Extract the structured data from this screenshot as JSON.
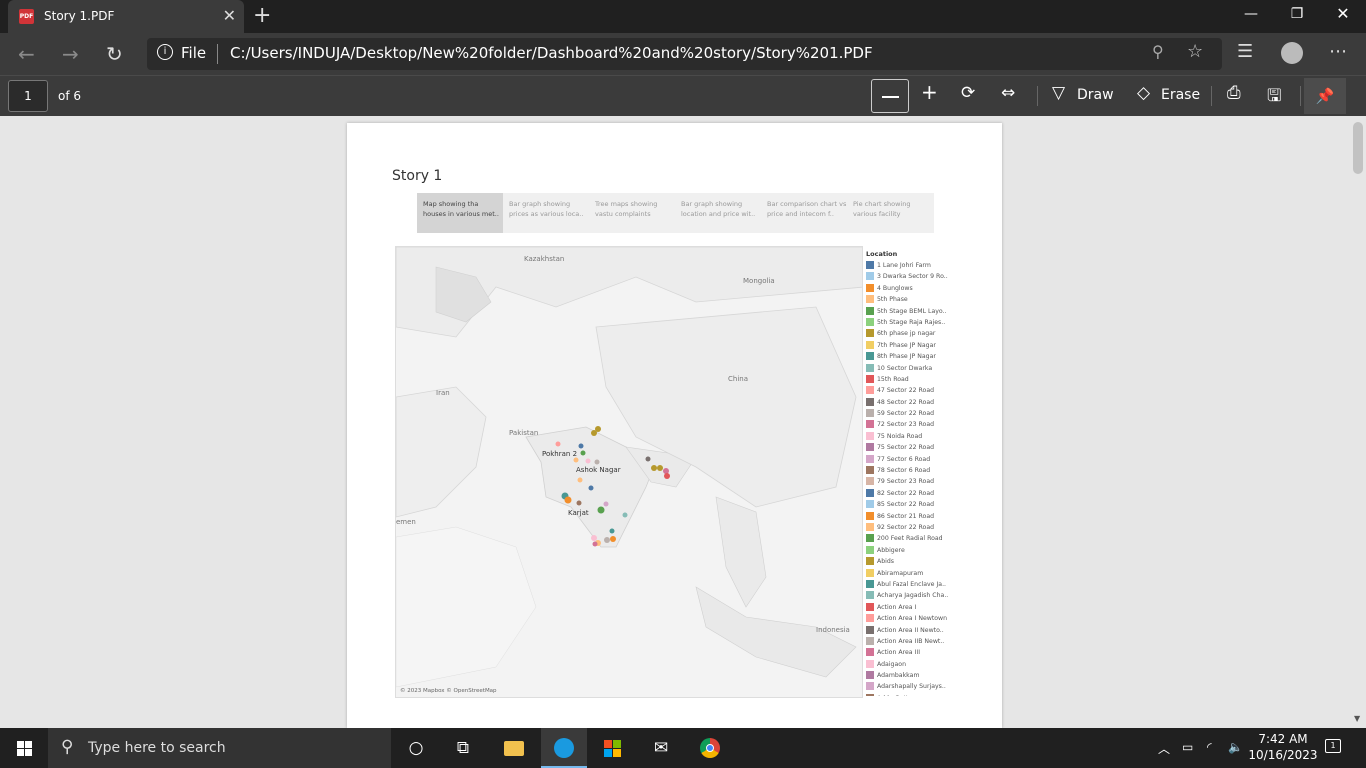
{
  "browser": {
    "tab_title": "Story 1.PDF",
    "tab_icon_text": "PDF",
    "address_scheme": "File",
    "url": "C:/Users/INDUJA/Desktop/New%20folder/Dashboard%20and%20story/Story%201.PDF"
  },
  "pdf_toolbar": {
    "page_number": "1",
    "page_count": "of 6",
    "draw_label": "Draw",
    "erase_label": "Erase"
  },
  "document": {
    "story_title": "Story 1",
    "story_points": [
      {
        "label": "Map showing tha houses in various met.."
      },
      {
        "label": "Bar graph showing prices as various loca.."
      },
      {
        "label": "Tree maps showing vastu complaints"
      },
      {
        "label": "Bar graph showing location and price wit.."
      },
      {
        "label": "Bar comparison chart vs price and intecom f.."
      },
      {
        "label": "Pie chart showing various facility"
      }
    ],
    "map": {
      "labels": {
        "kazakhstan": "Kazakhstan",
        "mongolia": "Mongolia",
        "iran": "Iran",
        "china": "China",
        "pakistan": "Pakistan",
        "pokhran": "Pokhran 2",
        "ashok_nagar": "Ashok Nagar",
        "karjat": "Karjat",
        "yemen": "emen",
        "indonesia": "Indonesia"
      },
      "copyright": "© 2023 Mapbox © OpenStreetMap"
    },
    "legend": {
      "title": "Location",
      "items": [
        {
          "label": "1 Lane Johri Farm",
          "color": "#4e79a7"
        },
        {
          "label": "3 Dwarka Sector 9 Ro..",
          "color": "#a0cbe8"
        },
        {
          "label": "4 Bunglows",
          "color": "#f28e2b"
        },
        {
          "label": "5th Phase",
          "color": "#ffbe7d"
        },
        {
          "label": "5th Stage BEML Layo..",
          "color": "#59a14f"
        },
        {
          "label": "5th Stage Raja Rajes..",
          "color": "#8cd17d"
        },
        {
          "label": "6th phase jp nagar",
          "color": "#b6992d"
        },
        {
          "label": "7th Phase JP Nagar",
          "color": "#f1ce63"
        },
        {
          "label": "8th Phase JP Nagar",
          "color": "#499894"
        },
        {
          "label": "10 Sector Dwarka",
          "color": "#86bcb6"
        },
        {
          "label": "15th Road",
          "color": "#e15759"
        },
        {
          "label": "47 Sector 22 Road",
          "color": "#ff9d9a"
        },
        {
          "label": "48 Sector 22 Road",
          "color": "#79706e"
        },
        {
          "label": "59 Sector 22 Road",
          "color": "#bab0ac"
        },
        {
          "label": "72 Sector 23 Road",
          "color": "#d37295"
        },
        {
          "label": "75 Noida Road",
          "color": "#fabfd2"
        },
        {
          "label": "75 Sector 22 Road",
          "color": "#b07aa1"
        },
        {
          "label": "77 Sector 6 Road",
          "color": "#d4a6c8"
        },
        {
          "label": "78 Sector 6 Road",
          "color": "#9d7660"
        },
        {
          "label": "79 Sector 23 Road",
          "color": "#d7b5a6"
        },
        {
          "label": "82 Sector 22 Road",
          "color": "#4e79a7"
        },
        {
          "label": "85 Sector 22 Road",
          "color": "#a0cbe8"
        },
        {
          "label": "86 Sector 21 Road",
          "color": "#f28e2b"
        },
        {
          "label": "92 Sector 22 Road",
          "color": "#ffbe7d"
        },
        {
          "label": "200 Feet Radial Road",
          "color": "#59a14f"
        },
        {
          "label": "Abbigere",
          "color": "#8cd17d"
        },
        {
          "label": "Abids",
          "color": "#b6992d"
        },
        {
          "label": "Abiramapuram",
          "color": "#f1ce63"
        },
        {
          "label": "Abul Fazal Enclave Ja..",
          "color": "#499894"
        },
        {
          "label": "Acharya Jagadish Cha..",
          "color": "#86bcb6"
        },
        {
          "label": "Action Area I",
          "color": "#e15759"
        },
        {
          "label": "Action Area I Newtown",
          "color": "#ff9d9a"
        },
        {
          "label": "Action Area II Newto..",
          "color": "#79706e"
        },
        {
          "label": "Action Area IIB Newt..",
          "color": "#bab0ac"
        },
        {
          "label": "Action Area III",
          "color": "#d37295"
        },
        {
          "label": "Adaigaon",
          "color": "#fabfd2"
        },
        {
          "label": "Adambakkam",
          "color": "#b07aa1"
        },
        {
          "label": "Adarshapally Surjays..",
          "color": "#d4a6c8"
        },
        {
          "label": "Adda Gutta",
          "color": "#9d7660"
        }
      ]
    }
  },
  "taskbar": {
    "search_placeholder": "Type here to search",
    "time": "7:42 AM",
    "date": "10/16/2023",
    "notification_count": "1"
  }
}
